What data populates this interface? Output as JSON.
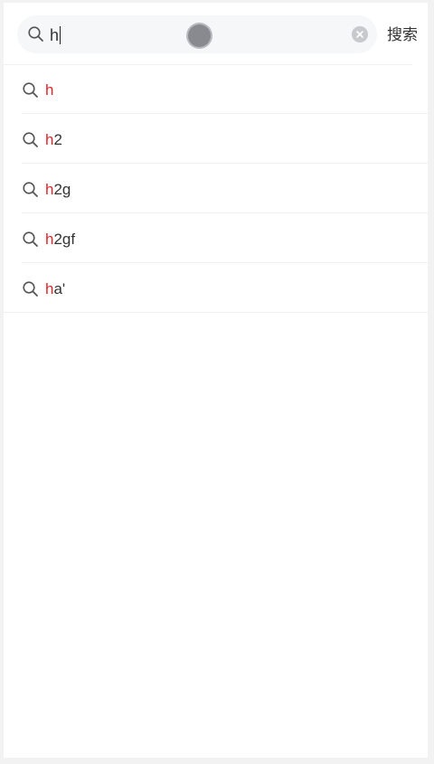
{
  "search": {
    "query": "h",
    "action_label": "搜索"
  },
  "history": [
    {
      "match": "h",
      "rest": ""
    },
    {
      "match": "h",
      "rest": "2"
    },
    {
      "match": "h",
      "rest": "2g"
    },
    {
      "match": "h",
      "rest": "2gf"
    },
    {
      "match": "h",
      "rest": "a'"
    }
  ],
  "colors": {
    "highlight": "#e0262b",
    "text": "#333333",
    "search_box_bg": "#f6f7f9"
  },
  "icons": {
    "search": "search-icon",
    "clear": "clear-icon",
    "touch": "touch-indicator"
  }
}
